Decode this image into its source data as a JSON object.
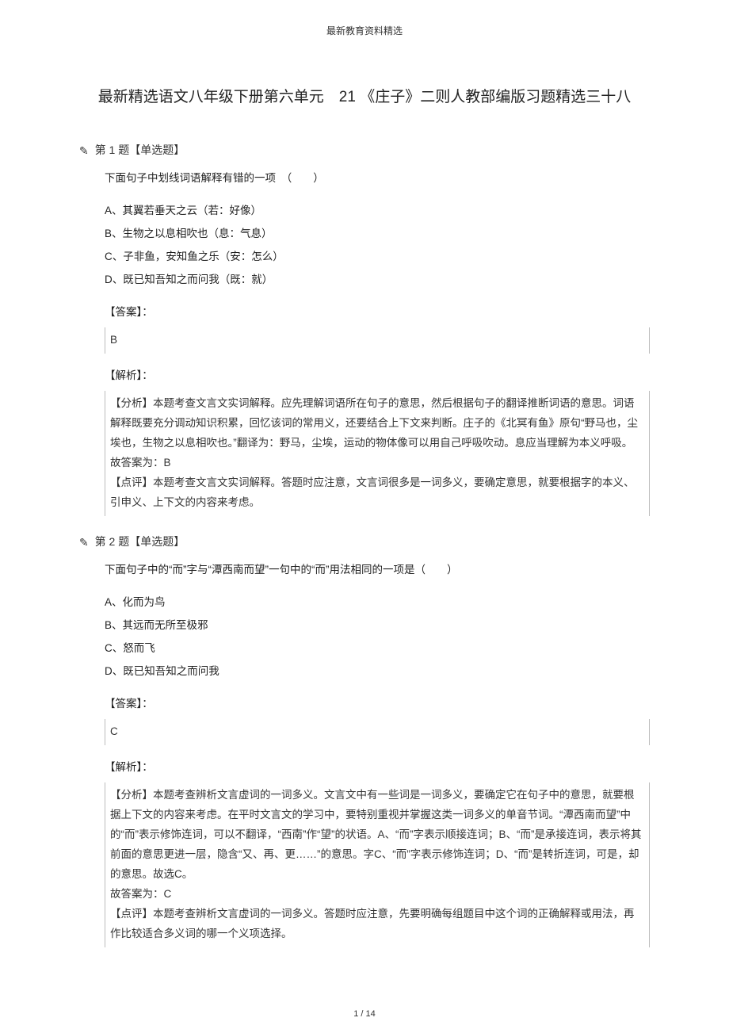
{
  "header": "最新教育资料精选",
  "title": "最新精选语文八年级下册第六单元　21 《庄子》二则人教部编版习题精选三十八",
  "q1": {
    "number": "第 1 题【单选题】",
    "stem": "下面句子中划线词语解释有错的一项　（　　）",
    "options": {
      "A": "A、其翼若垂天之云（若：好像）",
      "B": "B、生物之以息相吹也（息：气息）",
      "C": "C、子非鱼，安知鱼之乐（安：怎么）",
      "D": "D、既已知吾知之而问我（既：就）"
    },
    "answer_label": "【答案】：",
    "answer": "B",
    "analysis_label": "【解析】：",
    "analysis_p1": "【分析】本题考查文言文实词解释。应先理解词语所在句子的意思，然后根据句子的翻译推断词语的意思。词语解释既要充分调动知识积累，回忆该词的常用义，还要结合上下文来判断。庄子的《北冥有鱼》原句“野马也，尘埃也，生物之以息相吹也。”翻译为：野马，尘埃，运动的物体像可以用自己呼吸吹动。息应当理解为本义呼吸。",
    "analysis_ans": "故答案为：B",
    "analysis_p2": "【点评】本题考查文言文实词解释。答题时应注意，文言词很多是一词多义，要确定意思，就要根据字的本义、引申义、上下文的内容来考虑。"
  },
  "q2": {
    "number": "第 2 题【单选题】",
    "stem": "下面句子中的“而”字与“潭西南而望”一句中的“而”用法相同的一项是（　　）",
    "options": {
      "A": "A、化而为鸟",
      "B": "B、其远而无所至极邪",
      "C": "C、怒而飞",
      "D": "D、既已知吾知之而问我"
    },
    "answer_label": "【答案】：",
    "answer": "C",
    "analysis_label": "【解析】：",
    "analysis_p1": "【分析】本题考查辨析文言虚词的一词多义。文言文中有一些词是一词多义，要确定它在句子中的意思，就要根据上下文的内容来考虑。在平时文言文的学习中，要特别重视并掌握这类一词多义的单音节词。“潭西南而望”中的“而”表示修饰连词，可以不翻译，“西南”作“望”的状语。A、“而”字表示顺接连词；B、“而”是承接连词，表示将其前面的意思更进一层，隐含“又、再、更……”的意思。字C、“而”字表示修饰连词；D、“而”是转折连词，可是，却的意思。故选C。",
    "analysis_ans": "故答案为：C",
    "analysis_p2": "【点评】本题考查辨析文言虚词的一词多义。答题时应注意，先要明确每组题目中这个词的正确解释或用法，再作比较适合多义词的哪一个义项选择。"
  },
  "page_number": "1 / 14"
}
